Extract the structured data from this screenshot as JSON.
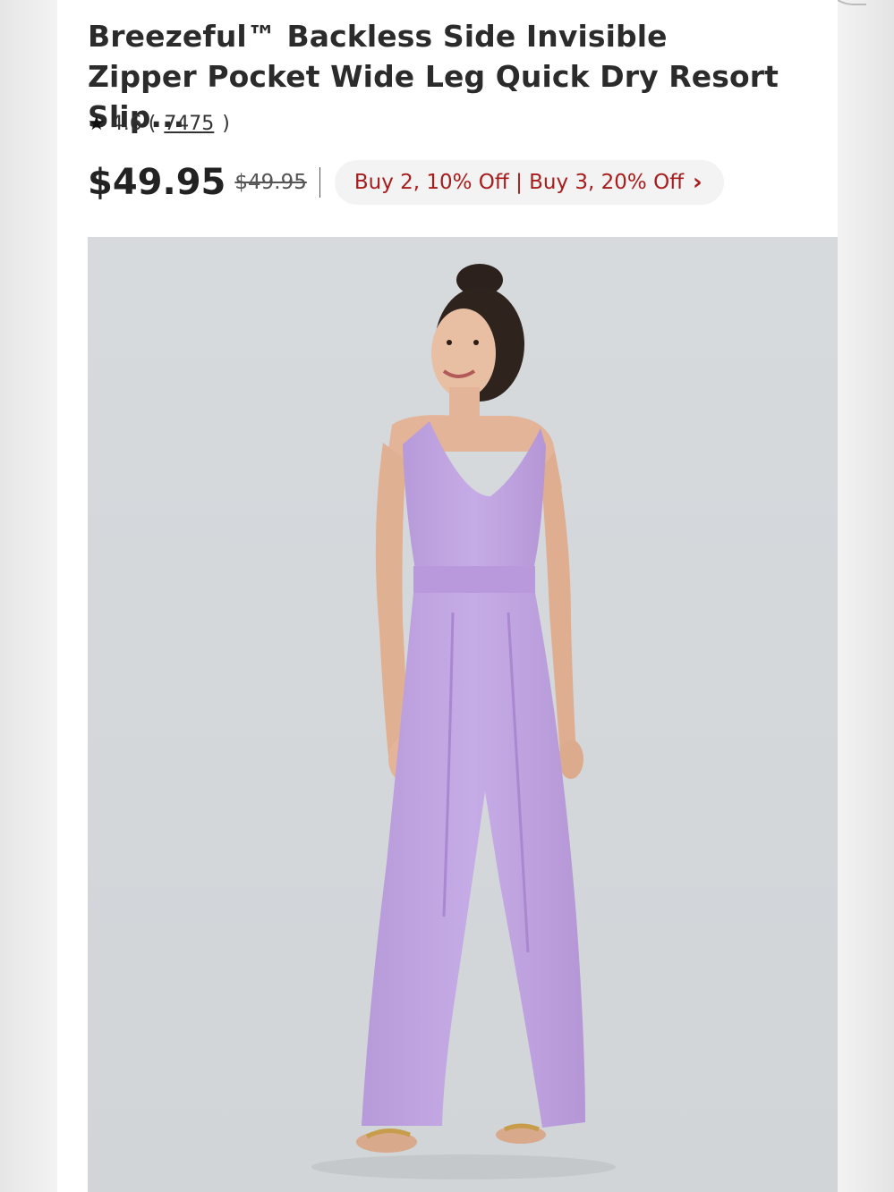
{
  "product": {
    "title": "Breezeful™ Backless Side Invisible Zipper Pocket Wide Leg Quick Dry Resort Slip...",
    "rating": "4.6",
    "review_count": "7475",
    "price": "$49.95",
    "original_price": "$49.95",
    "promo": "Buy 2, 10% Off | Buy 3, 20% Off",
    "image_icon": "model-photo"
  },
  "colors": {
    "promo_text": "#a81c1c",
    "garment": "#c0a6e0"
  }
}
